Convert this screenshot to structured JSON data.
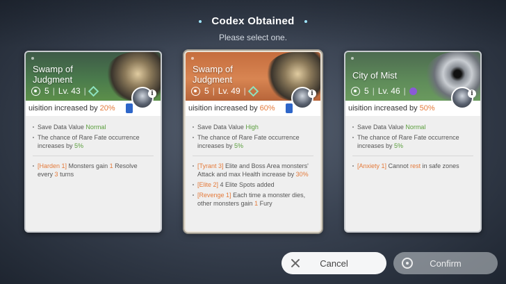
{
  "header": {
    "title": "Codex Obtained",
    "subtitle": "Please select one."
  },
  "cards": [
    {
      "name": "Swamp of Judgment",
      "stat_count": "5",
      "level": "Lv. 43",
      "bonus_text": "uisition increased by",
      "bonus_pct": "20%",
      "save_label": "Save Data Value",
      "save_value": "Normal",
      "fate_text": "The chance of Rare Fate occurrence increases by",
      "fate_pct": "5%",
      "effects": [
        {
          "tag": "[Harden 1]",
          "pre": "Monsters gain",
          "n1": "1",
          "mid": "Resolve every",
          "n2": "3",
          "post": "turns"
        }
      ]
    },
    {
      "name": "Swamp of Judgment",
      "stat_count": "5",
      "level": "Lv. 49",
      "bonus_text": "uisition increased by",
      "bonus_pct": "60%",
      "save_label": "Save Data Value",
      "save_value": "High",
      "fate_text": "The chance of Rare Fate occurrence increases by",
      "fate_pct": "5%",
      "effects": [
        {
          "tag": "[Tyrant 3]",
          "text": "Elite and Boss Area monsters' Attack and max Health increase by",
          "val": "30%"
        },
        {
          "tag": "[Elite 2]",
          "text": "4 Elite Spots added"
        },
        {
          "tag": "[Revenge 1]",
          "text": "Each time a monster dies, other monsters gain",
          "val": "1",
          "post": "Fury"
        }
      ]
    },
    {
      "name": "City of Mist",
      "stat_count": "5",
      "level": "Lv. 46",
      "bonus_text": "uisition increased by",
      "bonus_pct": "50%",
      "save_label": "Save Data Value",
      "save_value": "Normal",
      "fate_text": "The chance of Rare Fate occurrence increases by",
      "fate_pct": "5%",
      "effects": [
        {
          "tag": "[Anxiety 1]",
          "pre": "Cannot",
          "word": "rest",
          "post": "in safe zones"
        }
      ]
    }
  ],
  "buttons": {
    "cancel": "Cancel",
    "confirm": "Confirm"
  },
  "colors": {
    "accent_orange": "#e47a3a",
    "accent_green": "#5a9e3c"
  }
}
